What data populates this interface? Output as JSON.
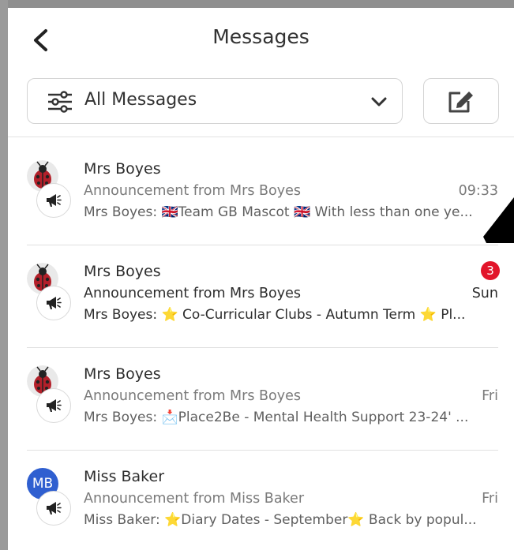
{
  "header": {
    "title": "Messages",
    "back_icon": "chevron-left-icon"
  },
  "filter": {
    "label": "All Messages",
    "icon": "sliders-icon",
    "chevron": "chevron-down-icon"
  },
  "compose": {
    "icon": "compose-icon"
  },
  "colors": {
    "badge": "#e2152a",
    "avatar_mb": "#2f5fd0",
    "divider": "#e0e0e0"
  },
  "messages": [
    {
      "sender": "Mrs Boyes",
      "subject": "Announcement from Mrs Boyes",
      "time": "09:33",
      "preview": "Mrs Boyes: 🇬🇧Team GB Mascot 🇬🇧 With less than one ye...",
      "avatar": "ladybird-icon",
      "unread": false
    },
    {
      "sender": "Mrs Boyes",
      "subject": "Announcement from Mrs Boyes",
      "time": "Sun",
      "badge": "3",
      "preview": "Mrs Boyes: ⭐ Co-Curricular Clubs - Autumn Term ⭐ Pl...",
      "avatar": "ladybird-icon",
      "unread": true
    },
    {
      "sender": "Mrs Boyes",
      "subject": "Announcement from Mrs Boyes",
      "time": "Fri",
      "preview": "Mrs Boyes: 📩Place2Be - Mental Health Support 23-24' ...",
      "avatar": "ladybird-icon",
      "unread": false
    },
    {
      "sender": "Miss Baker",
      "subject": "Announcement from Miss Baker",
      "time": "Fri",
      "preview": "Miss Baker: ⭐Diary Dates - September⭐ Back by popul...",
      "avatar_initials": "MB",
      "unread": false
    }
  ]
}
